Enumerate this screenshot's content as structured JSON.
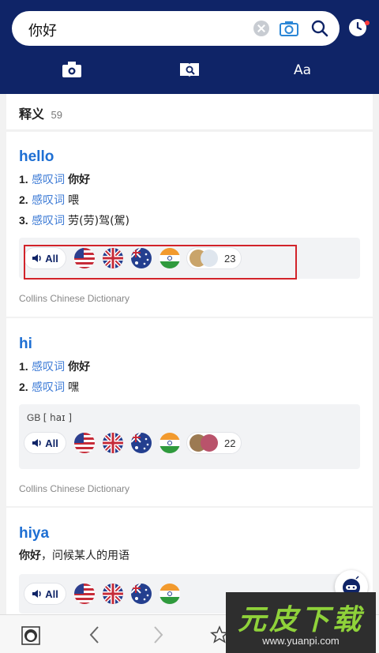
{
  "search": {
    "query": "你好"
  },
  "tools": {
    "text_label": "Aa"
  },
  "section": {
    "title": "释义",
    "count": "59"
  },
  "entries": [
    {
      "headword": "hello",
      "definitions": [
        {
          "num": "1.",
          "pos": "感叹词",
          "translation": "你好"
        },
        {
          "num": "2.",
          "pos": "感叹词",
          "translation": "喂"
        },
        {
          "num": "3.",
          "pos": "感叹词",
          "translation": "劳(劳)驾(駕)"
        }
      ],
      "all_label": "All",
      "pron_count": "23",
      "source": "Collins Chinese Dictionary"
    },
    {
      "headword": "hi",
      "definitions": [
        {
          "num": "1.",
          "pos": "感叹词",
          "translation": "你好"
        },
        {
          "num": "2.",
          "pos": "感叹词",
          "translation": "嘿"
        }
      ],
      "ipa_region": "GB",
      "ipa": "[ haɪ ]",
      "all_label": "All",
      "pron_count": "22",
      "source": "Collins Chinese Dictionary"
    },
    {
      "headword": "hiya",
      "gloss_bold": "你好",
      "gloss_rest": "，问候某人的用语",
      "all_label": "All"
    }
  ],
  "watermark": {
    "big": "元皮下载",
    "small": "www.yuanpi.com"
  },
  "colors": {
    "header": "#0f2467",
    "link": "#1e6fd3",
    "highlight": "#d2232a"
  }
}
